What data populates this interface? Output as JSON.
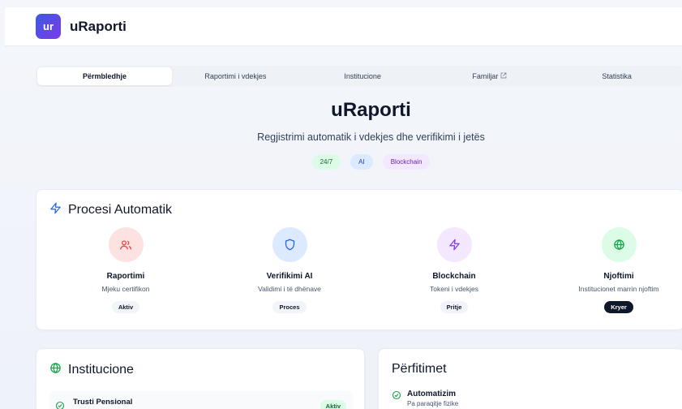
{
  "header": {
    "logo_text": "ur",
    "brand": "uRaporti"
  },
  "tabs": [
    {
      "label": "Përmbledhje",
      "active": true
    },
    {
      "label": "Raportimi i vdekjes"
    },
    {
      "label": "Institucione"
    },
    {
      "label": "Familjar",
      "external_icon": "external-link-icon"
    },
    {
      "label": "Statistika"
    }
  ],
  "hero": {
    "title": "uRaporti",
    "subtitle": "Regjistrimi automatik i vdekjes dhe verifikimi i jetës",
    "badges": [
      "24/7",
      "AI",
      "Blockchain"
    ]
  },
  "process": {
    "title": "Procesi Automatik",
    "icon": "lightning-icon",
    "steps": [
      {
        "name": "Raportimi",
        "desc": "Mjeku certifikon",
        "status": "Aktiv",
        "icon": "users-icon",
        "color": "#ef4444"
      },
      {
        "name": "Verifikimi AI",
        "desc": "Validimi i të dhënave",
        "status": "Proces",
        "icon": "shield-icon",
        "color": "#2563eb"
      },
      {
        "name": "Blockchain",
        "desc": "Tokeni i vdekjes",
        "status": "Pritje",
        "icon": "lightning-icon",
        "color": "#7c3aed"
      },
      {
        "name": "Njoftimi",
        "desc": "Institucionet marrin njoftim",
        "status": "Kryer",
        "icon": "globe-icon",
        "color": "#16a34a"
      }
    ]
  },
  "institutions": {
    "title": "Institucione",
    "icon": "globe-icon",
    "items": [
      {
        "name": "Trusti Pensional",
        "status": "Aktiv"
      }
    ]
  },
  "benefits": {
    "title": "Përfitimet",
    "items": [
      {
        "name": "Automatizim",
        "desc": "Pa paraqitje fizike"
      }
    ]
  },
  "colors": {
    "accent": "#2563eb",
    "success": "#16a34a",
    "brand_gradient_start": "#3b5bdb",
    "brand_gradient_end": "#7c3aed"
  }
}
